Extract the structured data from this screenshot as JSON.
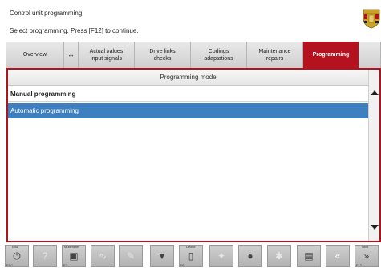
{
  "header": {
    "title": "Control unit programming",
    "instruction": "Select programming. Press [F12] to continue."
  },
  "tabs": [
    {
      "label": "Overview"
    },
    {
      "label": "↔"
    },
    {
      "label": "Actual values\ninput signals"
    },
    {
      "label": "Drive links\nchecks"
    },
    {
      "label": "Codings\nadaptations"
    },
    {
      "label": "Maintenance\nrepairs"
    },
    {
      "label": "Programming"
    }
  ],
  "panel": {
    "header": "Programming mode",
    "rows": [
      {
        "label": "Manual programming"
      },
      {
        "label": "Automatic programming",
        "selected": true
      }
    ]
  },
  "toolbar": {
    "end_label": "End",
    "end_key": "ESC",
    "multimeter_label": "Multimeter",
    "multimeter_key": "F2",
    "delete_label": "Delete",
    "delete_key": "F6",
    "next_label": "Next",
    "next_key": "F12"
  },
  "colors": {
    "accent": "#b4121e",
    "selection": "#3e7fbf"
  }
}
